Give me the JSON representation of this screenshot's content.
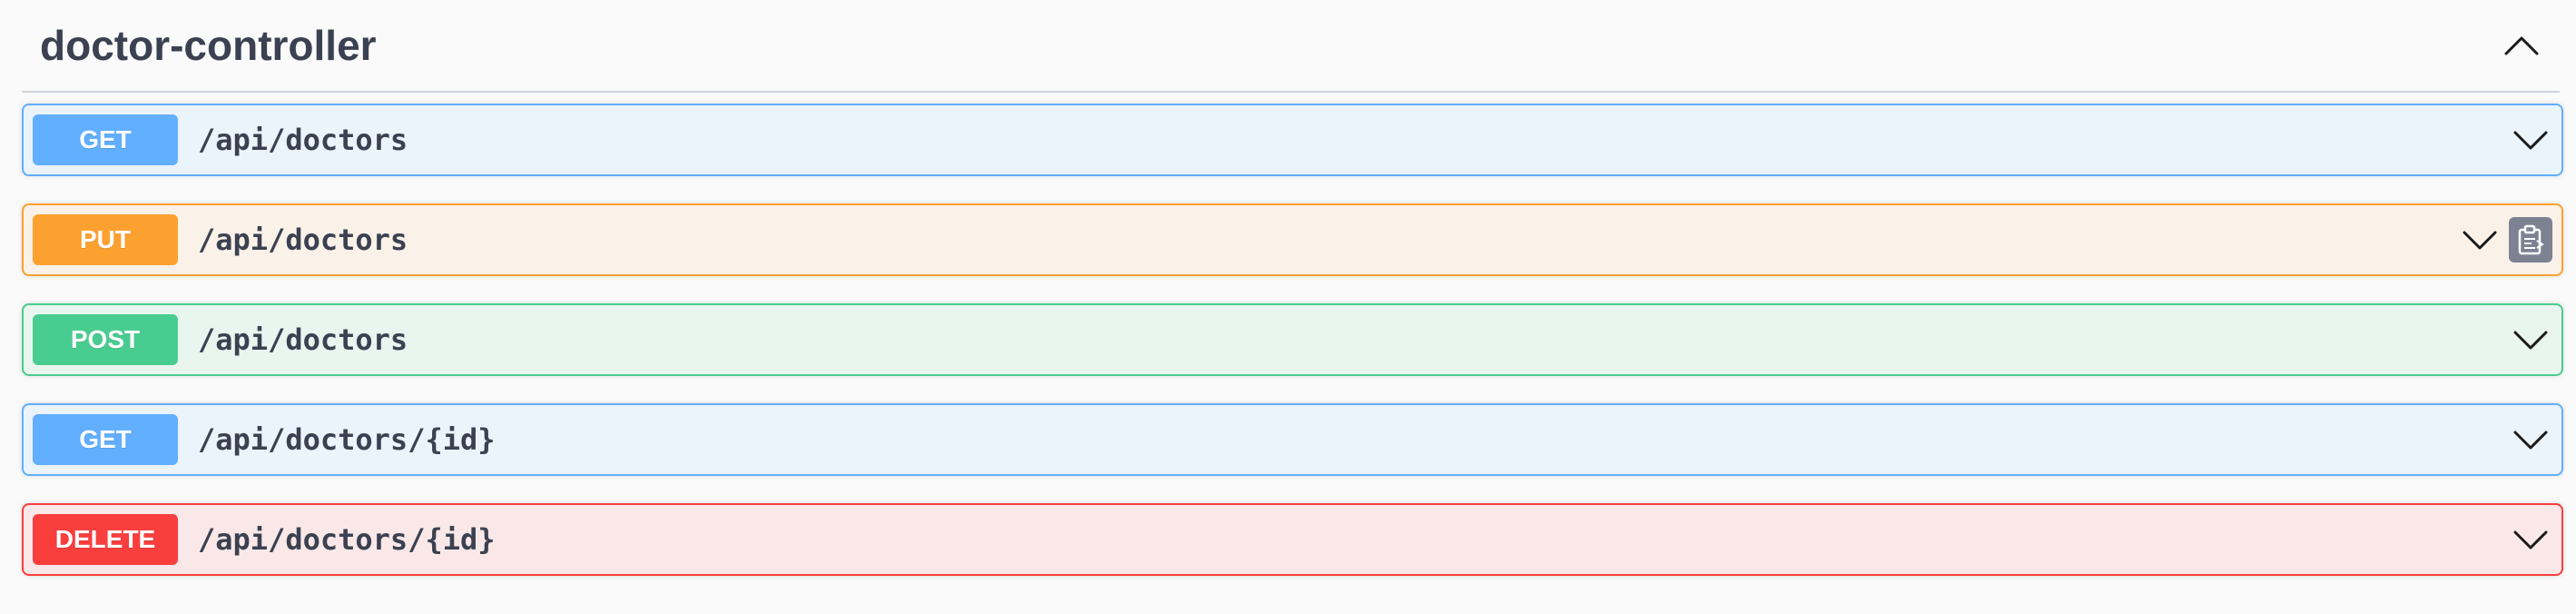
{
  "section": {
    "title": "doctor-controller",
    "collapse_icon": "chevron-up-icon"
  },
  "operations": [
    {
      "method": "GET",
      "path": "/api/doctors",
      "color": "#61affe"
    },
    {
      "method": "PUT",
      "path": "/api/doctors",
      "color": "#fca130",
      "has_copy_button": true
    },
    {
      "method": "POST",
      "path": "/api/doctors",
      "color": "#49cc90"
    },
    {
      "method": "GET",
      "path": "/api/doctors/{id}",
      "color": "#61affe"
    },
    {
      "method": "DELETE",
      "path": "/api/doctors/{id}",
      "color": "#f93e3e"
    }
  ],
  "icons": {
    "expand": "chevron-down-icon",
    "copy": "clipboard-icon"
  }
}
